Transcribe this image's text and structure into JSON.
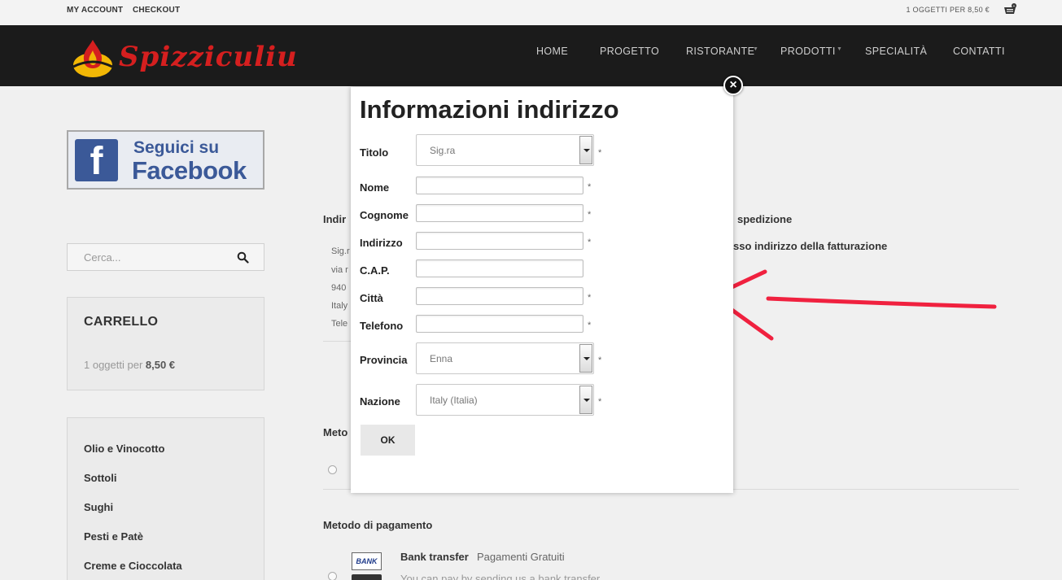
{
  "topbar": {
    "my_account": "MY ACCOUNT",
    "checkout": "CHECKOUT",
    "cart_summary": "1 OGGETTI PER 8,50 €",
    "basket_icon": "basket-icon"
  },
  "header": {
    "logo_text": "Spizziculiu",
    "nav": [
      {
        "label": "HOME"
      },
      {
        "label": "PROGETTO"
      },
      {
        "label": "RISTORANTE",
        "has_submenu": true
      },
      {
        "label": "PRODOTTI",
        "has_submenu": true
      },
      {
        "label": "SPECIALITÀ"
      },
      {
        "label": "CONTATTI"
      }
    ]
  },
  "sidebar": {
    "facebook": {
      "line1": "Seguici su",
      "line2": "Facebook",
      "letter": "f"
    },
    "search": {
      "placeholder": "Cerca..."
    },
    "cart": {
      "title": "CARRELLO",
      "info_prefix": "1 oggetti per ",
      "info_amount": "8,50 €"
    },
    "categories": [
      "Olio e Vinocotto",
      "Sottoli",
      "Sughi",
      "Pesti e Patè",
      "Creme e Cioccolata"
    ]
  },
  "background_page": {
    "billing_heading_partial": "Indir",
    "shipping_heading_partial": "spedizione",
    "same_as_billing_partial": "sso indirizzo della fatturazione",
    "address_lines_partial": [
      "Sig.r",
      "via r",
      "940",
      "Italy",
      "Tele"
    ],
    "shipping_method_partial": "Meto",
    "payment_method_heading": "Metodo di pagamento",
    "bank_icon_text": "BANK",
    "bank_transfer_label": "Bank transfer",
    "bank_transfer_fee": "Pagamenti Gratuiti",
    "bank_transfer_desc_partial": "You can pay by sending us a bank transfer"
  },
  "modal": {
    "title": "Informazioni indirizzo",
    "close_icon": "close-icon",
    "fields": {
      "titolo": {
        "label": "Titolo",
        "value": "Sig.ra",
        "required": "*"
      },
      "nome": {
        "label": "Nome",
        "value": "",
        "required": "*"
      },
      "cognome": {
        "label": "Cognome",
        "value": "",
        "required": "*"
      },
      "indirizzo": {
        "label": "Indirizzo",
        "value": "",
        "required": "*"
      },
      "cap": {
        "label": "C.A.P.",
        "value": ""
      },
      "citta": {
        "label": "Città",
        "value": "",
        "required": "*"
      },
      "telefono": {
        "label": "Telefono",
        "value": "",
        "required": "*"
      },
      "provincia": {
        "label": "Provincia",
        "value": "Enna",
        "required": "*"
      },
      "nazione": {
        "label": "Nazione",
        "value": "Italy (Italia)",
        "required": "*"
      }
    },
    "ok_label": "OK"
  },
  "colors": {
    "header_bg": "#1b1b1b",
    "brand_red": "#d51f1f",
    "annotation_arrow": "#f0213f",
    "facebook_blue": "#3b5998"
  }
}
